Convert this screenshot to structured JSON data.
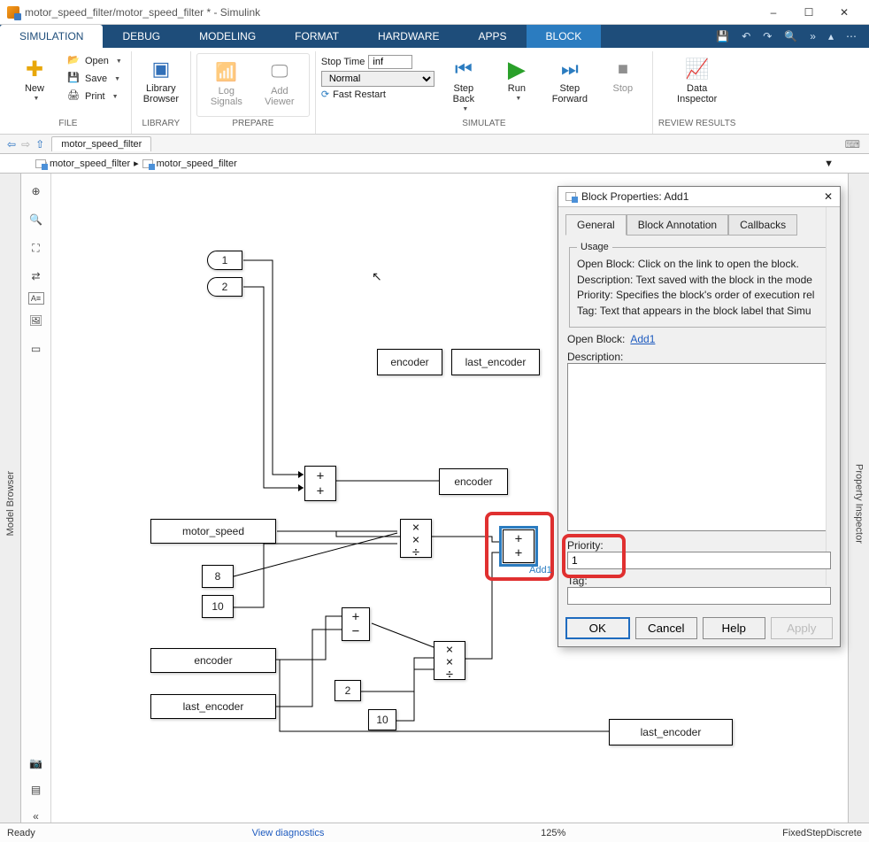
{
  "window": {
    "title": "motor_speed_filter/motor_speed_filter * - Simulink"
  },
  "mainTabs": {
    "simulation": "SIMULATION",
    "debug": "DEBUG",
    "modeling": "MODELING",
    "format": "FORMAT",
    "hardware": "HARDWARE",
    "apps": "APPS",
    "block": "BLOCK"
  },
  "ribbon": {
    "file": {
      "new": "New",
      "open": "Open",
      "save": "Save",
      "print": "Print",
      "group": "FILE"
    },
    "library": {
      "btn": "Library\nBrowser",
      "group": "LIBRARY"
    },
    "prepare": {
      "log": "Log\nSignals",
      "viewer": "Add\nViewer",
      "group": "PREPARE"
    },
    "sim": {
      "stopTimeLabel": "Stop Time",
      "stopTimeValue": "inf",
      "modeValue": "Normal",
      "fastRestart": "Fast Restart",
      "stepBack": "Step\nBack",
      "run": "Run",
      "stepFwd": "Step\nForward",
      "stop": "Stop",
      "group": "SIMULATE"
    },
    "review": {
      "btn": "Data\nInspector",
      "group": "REVIEW RESULTS"
    }
  },
  "nav": {
    "tab": "motor_speed_filter",
    "crumb1": "motor_speed_filter",
    "crumb2": "motor_speed_filter"
  },
  "panels": {
    "left": "Model Browser",
    "right": "Property Inspector"
  },
  "blocks": {
    "in1": "1",
    "in2": "2",
    "encoder_tag": "encoder",
    "last_encoder_tag": "last_encoder",
    "encoder_ds": "encoder",
    "motor_speed": "motor_speed",
    "k8": "8",
    "k10a": "10",
    "encoder_from": "encoder",
    "last_encoder_from": "last_encoder",
    "k2": "2",
    "k10b": "10",
    "add1_label": "Add1",
    "last_encoder_ds": "last_encoder"
  },
  "dialog": {
    "title": "Block Properties: Add1",
    "tabs": {
      "general": "General",
      "anno": "Block Annotation",
      "cb": "Callbacks"
    },
    "usageTitle": "Usage",
    "usage1": "Open Block: Click on the link to open the block.",
    "usage2": "Description: Text saved with the block in the mode",
    "usage3": "Priority: Specifies the block's order of execution rel",
    "usage4": "Tag: Text that appears in the block label that Simu",
    "openLabel": "Open Block:",
    "openLink": "Add1",
    "descLabel": "Description:",
    "descValue": "",
    "prioLabel": "Priority:",
    "prioValue": "1",
    "tagLabel": "Tag:",
    "tagValue": "",
    "ok": "OK",
    "cancel": "Cancel",
    "help": "Help",
    "apply": "Apply"
  },
  "status": {
    "ready": "Ready",
    "diag": "View diagnostics",
    "zoom": "125%",
    "solver": "FixedStepDiscrete"
  }
}
